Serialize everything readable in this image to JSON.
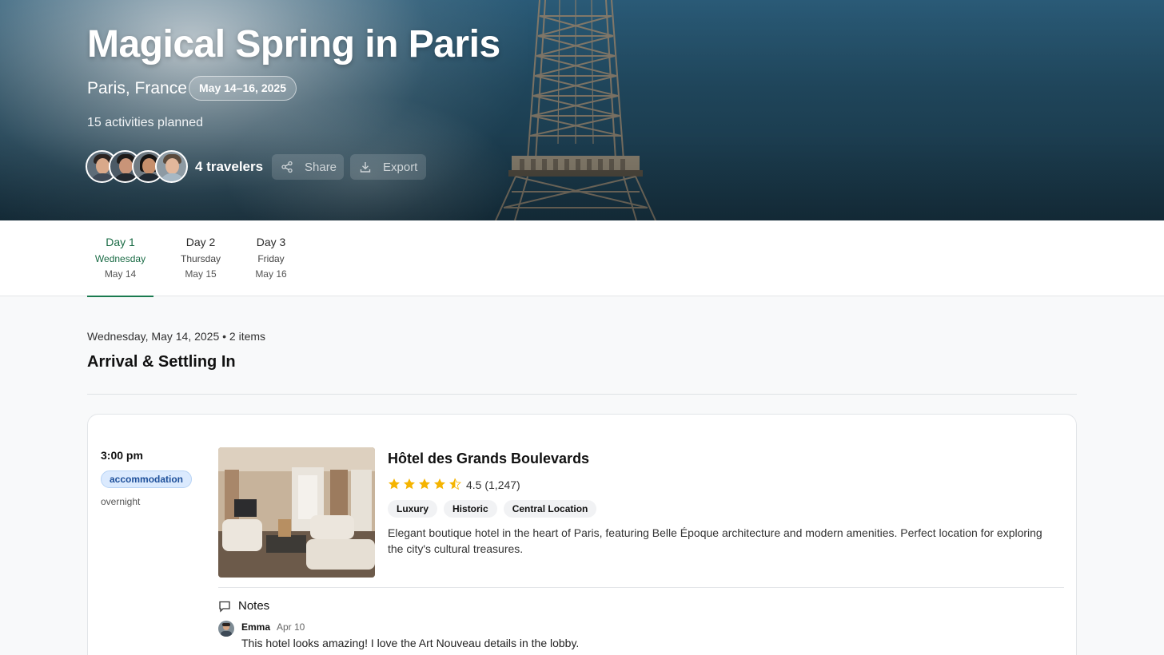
{
  "trip": {
    "title": "Magical Spring in Paris",
    "location": "Paris, France",
    "dates": "May 14–16, 2025",
    "activities": "15 activities planned",
    "travelers_label": "4 travelers",
    "share_label": "Share",
    "export_label": "Export",
    "avatars": [
      "traveler-1",
      "traveler-2",
      "traveler-3",
      "traveler-4"
    ]
  },
  "tabs": [
    {
      "day": "Day 1",
      "weekday": "Wednesday",
      "date": "May 14",
      "active": true
    },
    {
      "day": "Day 2",
      "weekday": "Thursday",
      "date": "May 15",
      "active": false
    },
    {
      "day": "Day 3",
      "weekday": "Friday",
      "date": "May 16",
      "active": false
    }
  ],
  "day": {
    "meta": "Wednesday, May 14, 2025 • 2 items",
    "title": "Arrival & Settling In"
  },
  "item": {
    "time": "3:00 pm",
    "type": "accommodation",
    "duration": "overnight",
    "name": "Hôtel des Grands Boulevards",
    "stars": 4.5,
    "rating_text": "4.5 (1,247)",
    "tags": [
      "Luxury",
      "Historic",
      "Central Location"
    ],
    "description": "Elegant boutique hotel in the heart of Paris, featuring Belle Époque architecture and modern amenities. Perfect location for exploring the city's cultural treasures.",
    "notes_label": "Notes",
    "note": {
      "author": "Emma",
      "date": "Apr 10",
      "text": "This hotel looks amazing! I love the Art Nouveau details in the lobby."
    }
  },
  "colors": {
    "accent": "#1a7a4f",
    "badge_bg": "#dbeafe",
    "badge_text": "#1d4f9a",
    "star": "#f5b400"
  }
}
